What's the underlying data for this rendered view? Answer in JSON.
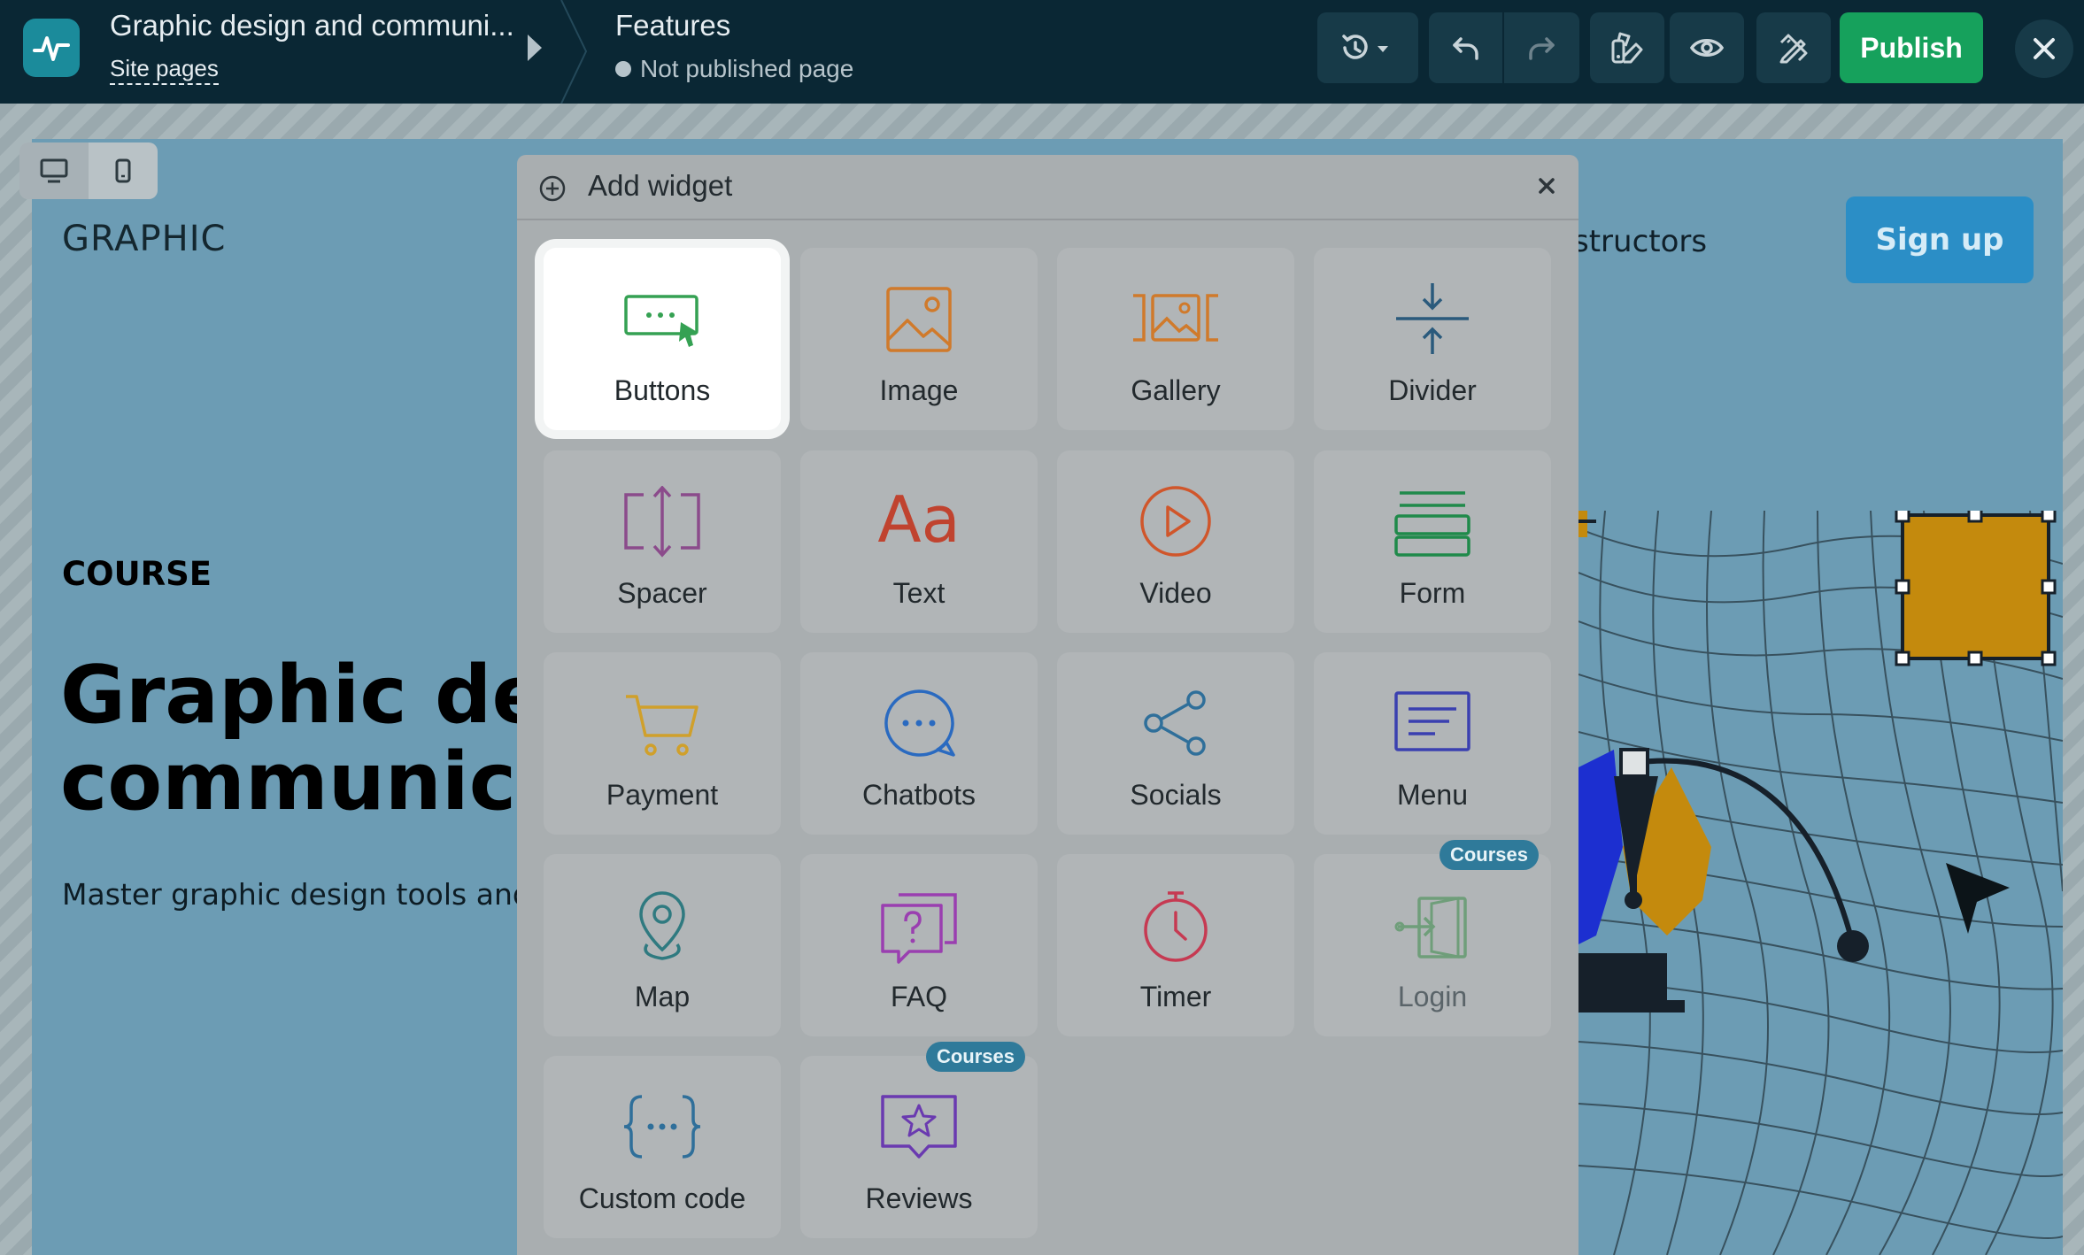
{
  "header": {
    "site_title": "Graphic design and communi...",
    "site_pages": "Site pages",
    "page_title": "Features",
    "page_status": "Not published page",
    "publish": "Publish"
  },
  "site": {
    "brand": "GRAPHIC",
    "nav_partial": "structors",
    "signup": "Sign up",
    "eyebrow": "COURSE",
    "hero_line1": "Graphic de",
    "hero_line2": "communic",
    "subtitle": "Master graphic design tools and"
  },
  "panel": {
    "title": "Add widget",
    "widgets": [
      {
        "label": "Buttons",
        "icon": "buttons-icon"
      },
      {
        "label": "Image",
        "icon": "image-icon"
      },
      {
        "label": "Gallery",
        "icon": "gallery-icon"
      },
      {
        "label": "Divider",
        "icon": "divider-icon"
      },
      {
        "label": "Spacer",
        "icon": "spacer-icon"
      },
      {
        "label": "Text",
        "icon": "text-icon",
        "glyph": "Aa"
      },
      {
        "label": "Video",
        "icon": "video-icon"
      },
      {
        "label": "Form",
        "icon": "form-icon"
      },
      {
        "label": "Payment",
        "icon": "cart-icon"
      },
      {
        "label": "Chatbots",
        "icon": "chat-icon"
      },
      {
        "label": "Socials",
        "icon": "share-icon"
      },
      {
        "label": "Menu",
        "icon": "menu-icon"
      },
      {
        "label": "Map",
        "icon": "map-pin-icon"
      },
      {
        "label": "FAQ",
        "icon": "faq-icon"
      },
      {
        "label": "Timer",
        "icon": "stopwatch-icon"
      },
      {
        "label": "Login",
        "icon": "login-icon",
        "badge": "Courses"
      },
      {
        "label": "Custom code",
        "icon": "code-braces-icon"
      },
      {
        "label": "Reviews",
        "icon": "review-star-icon",
        "badge": "Courses"
      }
    ]
  },
  "colors": {
    "topbar": "#0a2734",
    "publish": "#16a15c",
    "canvas": "#6c9cb4",
    "signup": "#2b8ec6",
    "badge": "#2f7a9a"
  }
}
